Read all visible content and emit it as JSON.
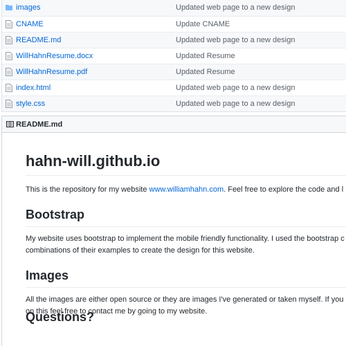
{
  "files": [
    {
      "name": "images",
      "type": "folder",
      "message": "Updated web page to a new design"
    },
    {
      "name": "CNAME",
      "type": "file",
      "message": "Update CNAME"
    },
    {
      "name": "README.md",
      "type": "file",
      "message": "Updated web page to a new design"
    },
    {
      "name": "WillHahnResume.docx",
      "type": "file",
      "message": "Updated Resume"
    },
    {
      "name": "WillHahnResume.pdf",
      "type": "file",
      "message": "Updated Resume"
    },
    {
      "name": "index.html",
      "type": "file",
      "message": "Updated web page to a new design"
    },
    {
      "name": "style.css",
      "type": "file",
      "message": "Updated web page to a new design"
    }
  ],
  "readme": {
    "header_title": "README.md",
    "icon": "book-icon",
    "h1": "hahn-will.github.io",
    "intro_before": "This is the repository for my website ",
    "intro_link": "www.williamhahn.com",
    "intro_after": ". Feel free to explore the code and l",
    "sections": [
      {
        "heading": "Bootstrap",
        "lines": [
          "My website uses bootstrap to implement the mobile friendly functionality. I used the bootstrap c",
          "combinations of their examples to create the design for this website."
        ]
      },
      {
        "heading": "Images",
        "lines": [
          "All the images are either open source or they are images I've generated or taken myself. If you",
          "on this feel free to contact me by going to my website."
        ]
      },
      {
        "heading": "Questions?",
        "lines": []
      }
    ]
  },
  "colors": {
    "link": "#0366d6",
    "muted": "#586069",
    "border": "#dfe2e5"
  }
}
